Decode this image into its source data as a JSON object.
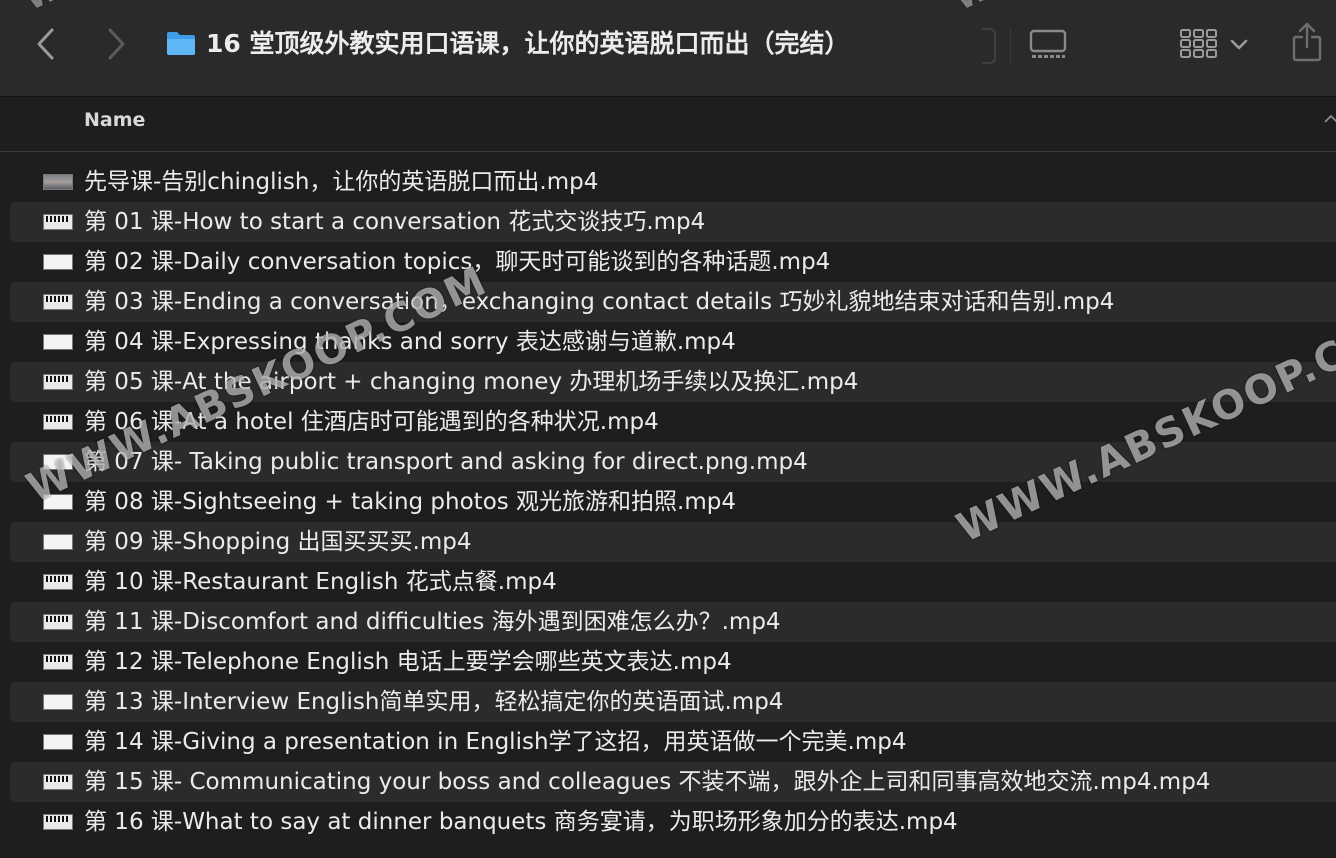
{
  "toolbar": {
    "title": "16 堂顶级外教实用口语课，让你的英语脱口而出（完结）",
    "back_icon": "chevron-left-icon",
    "forward_icon": "chevron-right-icon",
    "folder_icon": "folder-icon",
    "gallery_icon": "gallery-view-icon",
    "view_icon": "grid-view-icon",
    "share_icon": "share-icon",
    "folder_color": "#4aa8f0"
  },
  "columns": {
    "name_label": "Name"
  },
  "files": [
    {
      "name": "先导课-告别chinglish，让你的英语脱口而出.mp4",
      "thumb": "photo"
    },
    {
      "name": "第 01 课-How to start a conversation 花式交谈技巧.mp4",
      "thumb": "dark"
    },
    {
      "name": "第 02 课-Daily conversation topics，聊天时可能谈到的各种话题.mp4",
      "thumb": "light"
    },
    {
      "name": "第 03 课-Ending a conversation，exchanging contact details 巧妙礼貌地结束对话和告别.mp4",
      "thumb": "dark"
    },
    {
      "name": "第 04 课-Expressing thanks and sorry 表达感谢与道歉.mp4",
      "thumb": "light"
    },
    {
      "name": "第 05 课-At the airport + changing money 办理机场手续以及换汇.mp4",
      "thumb": "dark"
    },
    {
      "name": "第 06 课-At a hotel 住酒店时可能遇到的各种状况.mp4",
      "thumb": "dark"
    },
    {
      "name": "第 07 课- Taking public transport and asking for direct.png.mp4",
      "thumb": "light"
    },
    {
      "name": "第 08 课-Sightseeing + taking photos 观光旅游和拍照.mp4",
      "thumb": "light"
    },
    {
      "name": "第 09 课-Shopping 出国买买买.mp4",
      "thumb": "light"
    },
    {
      "name": "第 10 课-Restaurant English 花式点餐.mp4",
      "thumb": "dark"
    },
    {
      "name": "第 11 课-Discomfort and difficulties 海外遇到困难怎么办？.mp4",
      "thumb": "dark"
    },
    {
      "name": "第 12 课-Telephone English 电话上要学会哪些英文表达.mp4",
      "thumb": "dark"
    },
    {
      "name": "第 13 课-Interview English简单实用，轻松搞定你的英语面试.mp4",
      "thumb": "light"
    },
    {
      "name": "第 14 课-Giving a presentation in English学了这招，用英语做一个完美.mp4",
      "thumb": "light"
    },
    {
      "name": "第 15 课- Communicating your boss and colleagues 不装不端，跟外企上司和同事高效地交流.mp4.mp4",
      "thumb": "dark"
    },
    {
      "name": "第 16 课-What to say at dinner banquets 商务宴请，为职场形象加分的表达.mp4",
      "thumb": "dark"
    }
  ],
  "watermark": "WWW.ABSKOOP.COM"
}
